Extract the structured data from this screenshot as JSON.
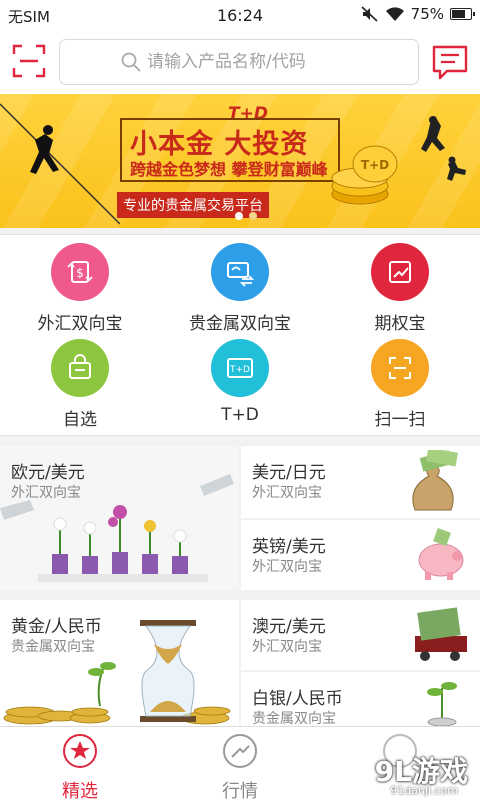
{
  "status_bar": {
    "carrier": "无SIM",
    "time": "16:24",
    "battery": "75%",
    "battery_level": 0.75
  },
  "header": {
    "search_placeholder": "请输入产品名称/代码"
  },
  "banner": {
    "badge": "T+D",
    "headline": "小本金 大投资",
    "subline": "跨越金色梦想 攀登财富巅峰",
    "tagline": "专业的贵金属交易平台",
    "page_count": 2,
    "active_page": 1
  },
  "grid": [
    {
      "label": "外汇双向宝",
      "icon": "forex-exchange-icon",
      "color": "#ef5a8a"
    },
    {
      "label": "贵金属双向宝",
      "icon": "precious-metal-icon",
      "color": "#2f9ee8"
    },
    {
      "label": "期权宝",
      "icon": "chart-trend-icon",
      "color": "#e0263c"
    },
    {
      "label": "自选",
      "icon": "shopping-bag-icon",
      "color": "#8cc63f"
    },
    {
      "label": "T+D",
      "icon": "td-card-icon",
      "color": "#21bfd8"
    },
    {
      "label": "扫一扫",
      "icon": "scan-icon",
      "color": "#f5a623"
    }
  ],
  "products": [
    {
      "name": "欧元/美元",
      "category": "外汇双向宝",
      "image": "flowers-watering-image"
    },
    {
      "name": "美元/日元",
      "category": "外汇双向宝",
      "image": "money-bag-image"
    },
    {
      "name": "英镑/美元",
      "category": "外汇双向宝",
      "image": "piggy-bank-image"
    },
    {
      "name": "黄金/人民币",
      "category": "贵金属双向宝",
      "image": "hourglass-coins-image"
    },
    {
      "name": "澳元/美元",
      "category": "外汇双向宝",
      "image": "money-cart-image"
    },
    {
      "name": "白银/人民币",
      "category": "贵金属双向宝",
      "image": "coin-plant-image"
    }
  ],
  "bottom_nav": [
    {
      "label": "精选",
      "icon": "star-icon",
      "active": true
    },
    {
      "label": "行情",
      "icon": "trend-icon",
      "active": false
    }
  ],
  "watermark": {
    "text": "9L游戏",
    "site": "91danji.com"
  },
  "colors": {
    "accent": "#e0263c",
    "banner_yellow": "#fbc21c",
    "banner_red": "#c8291a"
  }
}
